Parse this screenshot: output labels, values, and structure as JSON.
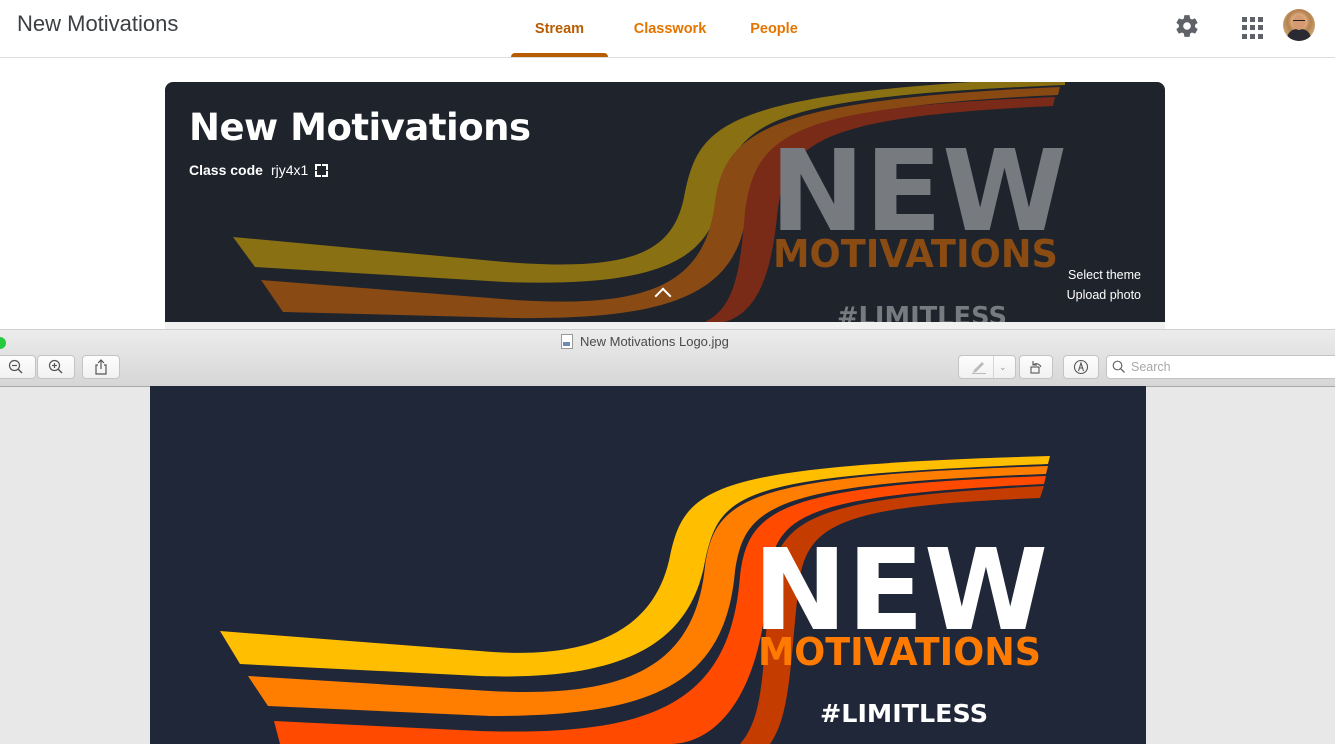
{
  "classroom": {
    "app_title": "New Motivations",
    "tabs": [
      {
        "label": "Stream",
        "active": true
      },
      {
        "label": "Classwork",
        "active": false
      },
      {
        "label": "People",
        "active": false
      }
    ],
    "accent_color": "#b85c00",
    "tab_color": "#e37400",
    "icons": {
      "settings": "gear-icon",
      "apps": "apps-grid-icon",
      "account": "avatar"
    },
    "banner": {
      "title": "New Motivations",
      "class_code_label": "Class code",
      "class_code": "rjy4x1",
      "select_theme": "Select theme",
      "upload_photo": "Upload photo",
      "image_text": {
        "line1": "NEW",
        "line2": "MOTIVATIONS",
        "line3": "#LIMITLESS"
      }
    }
  },
  "preview": {
    "window_title": "New Motivations Logo.jpg",
    "toolbar": {
      "zoom_out": "zoom-out-icon",
      "zoom_in": "zoom-in-icon",
      "share": "share-icon",
      "markup": "pen-icon",
      "rotate": "rotate-icon",
      "annotate": "annotate-icon"
    },
    "search_placeholder": "Search",
    "image_text": {
      "line1": "NEW",
      "line2": "MOTIVATIONS",
      "line3": "#LIMITLESS"
    },
    "image_colors": {
      "background": "#1f2738",
      "white": "#ffffff",
      "orange": "#ff7a00"
    }
  }
}
